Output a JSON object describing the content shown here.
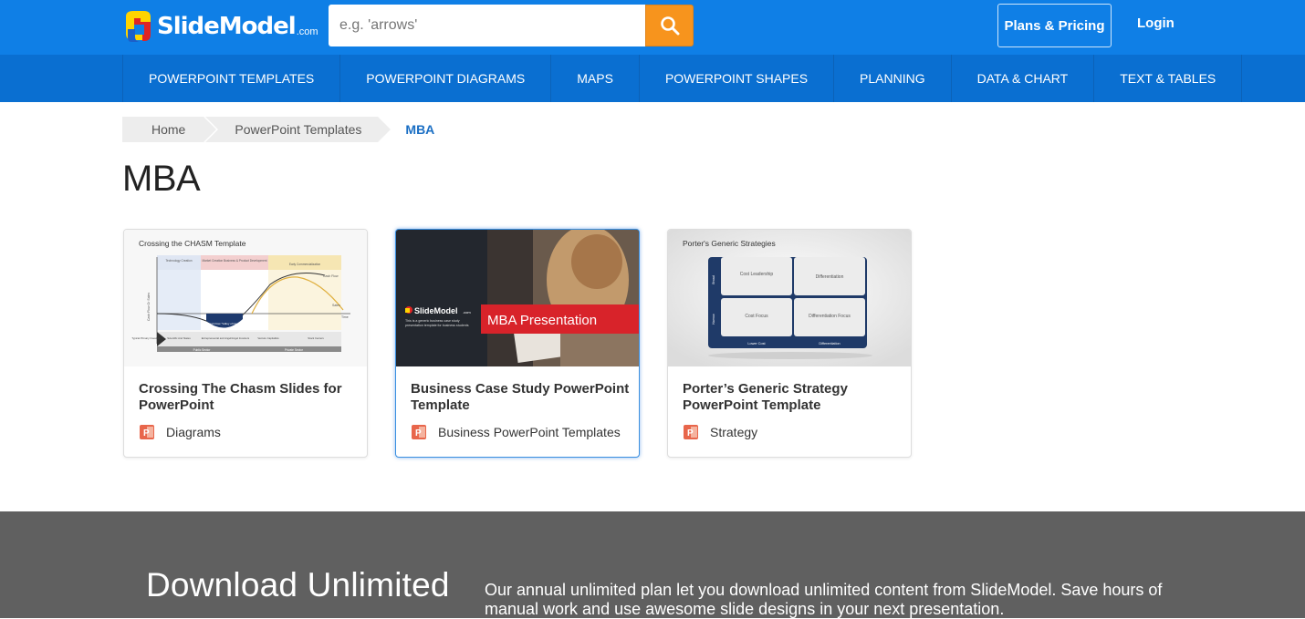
{
  "header": {
    "logo_text": "SlideModel",
    "logo_suffix": ".com",
    "search_placeholder": "e.g. 'arrows'",
    "plans_label": "Plans & Pricing",
    "login_label": "Login"
  },
  "nav": {
    "items": [
      {
        "label": "POWERPOINT TEMPLATES"
      },
      {
        "label": "POWERPOINT DIAGRAMS"
      },
      {
        "label": "MAPS"
      },
      {
        "label": "POWERPOINT SHAPES"
      },
      {
        "label": "PLANNING"
      },
      {
        "label": "DATA & CHART"
      },
      {
        "label": "TEXT & TABLES"
      }
    ]
  },
  "breadcrumb": {
    "home": "Home",
    "parent": "PowerPoint Templates",
    "current": "MBA"
  },
  "page": {
    "title": "MBA"
  },
  "cards": [
    {
      "title": "Crossing The Chasm Slides for PowerPoint",
      "category": "Diagrams",
      "thumb": {
        "heading": "Crossing the CHASM Template",
        "phases": [
          "Technology Creation",
          "Market Creation Business & Product Development",
          "Early Commercialization"
        ],
        "curve_labels": [
          "Cash Flow",
          "Sales",
          "Time",
          "Cash Flow \"Valley of Death\""
        ],
        "y_label": "Cash Flow Or Sales",
        "bottom_cells": [
          "Typical Primary Investors",
          "Scientific And States",
          "Entrepreneurial and Angel/Angel Investors",
          "Venture Capitalists",
          "Stock Centers"
        ],
        "bottom_footer": [
          "Public Sector",
          "Private Sector"
        ]
      }
    },
    {
      "title": "Business Case Study PowerPoint Template",
      "category": "Business PowerPoint Templates",
      "thumb": {
        "logo": "SlideModel",
        "logo_suffix": ".com",
        "banner": "MBA Presentation",
        "blurb": "This is a generic business case study presentation template for business students"
      }
    },
    {
      "title": "Porter’s Generic Strategy PowerPoint Template",
      "category": "Strategy",
      "thumb": {
        "heading": "Porter's Generic Strategies",
        "cells": [
          "Cost Leadership",
          "Differentiation",
          "Cost Focus",
          "Differentiation Focus"
        ],
        "side_labels": [
          "Broad",
          "Narrow"
        ],
        "bottom_labels": [
          "Lower Cost",
          "Differentiation"
        ]
      }
    }
  ],
  "promo": {
    "title": "Download Unlimited",
    "text": "Our annual unlimited plan let you download unlimited content from SlideModel. Save hours of manual work and use awesome slide designs in your next presentation."
  },
  "colors": {
    "header_blue": "#0f7fe6",
    "nav_blue": "#0a6fd1",
    "search_orange": "#f7941d",
    "promo_gray": "#606060",
    "banner_red": "#d8232a"
  },
  "icons": {
    "search": "magnifier-icon",
    "category": "powerpoint-file-icon"
  }
}
